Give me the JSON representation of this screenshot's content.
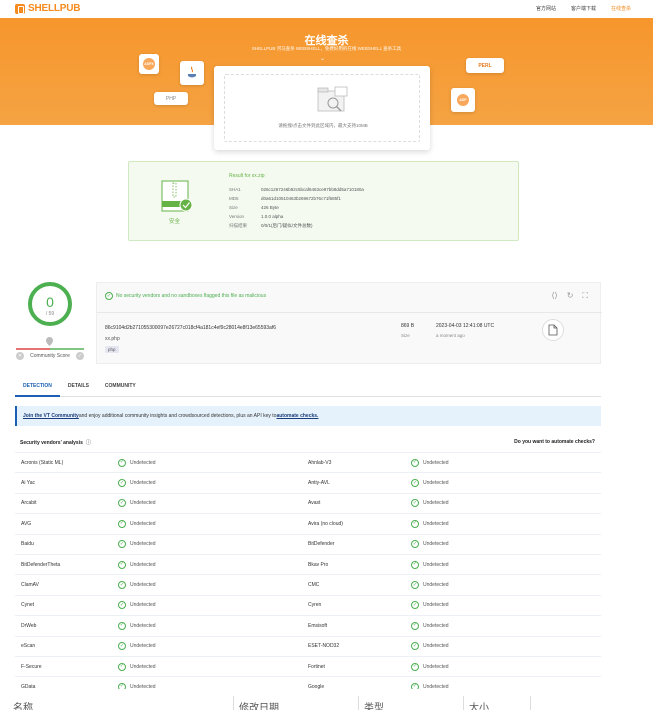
{
  "nav": {
    "logo": "SHELLPUB",
    "links": [
      "官方网站",
      "客户端下载",
      "在线查杀"
    ]
  },
  "hero": {
    "title": "在线查杀",
    "subtitle": "SHELLPUB 河马查杀 WEBSHELL，免费好用的在线 WEBSHELL 查杀工具",
    "badges": {
      "aspx": "ASPX",
      "php": "PHP",
      "perl": "PERL",
      "asp": "ASP"
    },
    "upload_hint": "请拖拽/点击文件到此区域内，最大支持10MB"
  },
  "result": {
    "title": "Result for xx.zip",
    "safe": "安全",
    "rows": [
      {
        "k": "SHA1",
        "v": "026c1267246b92c5bcaf6463ce97bb8dd5a710180a"
      },
      {
        "k": "MD5",
        "v": "d0a61d10510463b269672b76c71f685f1"
      },
      {
        "k": "Size",
        "v": "426 Byte"
      },
      {
        "k": "Version",
        "v": "1.0.0 alpha"
      },
      {
        "k": "扫描结果",
        "v": "0/0/1(后门/疑似/文件总数)"
      }
    ]
  },
  "vt": {
    "score": "0",
    "score_den": "/ 59",
    "community": "Community Score",
    "flag": "No security vendors and no sandboxes flagged this file as malicious",
    "hash": "86c9104d2b271055300097e26727c018cf4a181c4ef9c28014e8f13e65593af6",
    "filename": "xx.php",
    "tag": "php",
    "size": "869 B",
    "size_label": "Size",
    "date": "2023-04-03 12:41:08 UTC",
    "ago": "a moment ago"
  },
  "tabs": [
    "DETECTION",
    "DETAILS",
    "COMMUNITY"
  ],
  "banner": {
    "link1": "Join the VT Community",
    "text": " and enjoy additional community insights and crowdsourced detections, plus an API key to ",
    "link2": "automate checks."
  },
  "analysis": {
    "title": "Security vendors' analysis",
    "automate": "Do you want to automate checks?",
    "rows": [
      [
        "Acronis (Static ML)",
        "Undetected",
        "Ahnlab-V3",
        "Undetected"
      ],
      [
        "Ai Yac",
        "Undetected",
        "Antiy-AVL",
        "Undetected"
      ],
      [
        "Arcabit",
        "Undetected",
        "Avast",
        "Undetected"
      ],
      [
        "AVG",
        "Undetected",
        "Avira (no cloud)",
        "Undetected"
      ],
      [
        "Baidu",
        "Undetected",
        "BitDefender",
        "Undetected"
      ],
      [
        "BitDefenderTheta",
        "Undetected",
        "Bkav Pro",
        "Undetected"
      ],
      [
        "ClamAV",
        "Undetected",
        "CMC",
        "Undetected"
      ],
      [
        "Cynet",
        "Undetected",
        "Cyren",
        "Undetected"
      ],
      [
        "DrWeb",
        "Undetected",
        "Emsisoft",
        "Undetected"
      ],
      [
        "eScan",
        "Undetected",
        "ESET-NOD32",
        "Undetected"
      ],
      [
        "F-Secure",
        "Undetected",
        "Fortinet",
        "Undetected"
      ],
      [
        "GData",
        "Undetected",
        "Google",
        "Undetected"
      ]
    ]
  },
  "footer": [
    "名称",
    "修改日期",
    "类型",
    "大小"
  ]
}
